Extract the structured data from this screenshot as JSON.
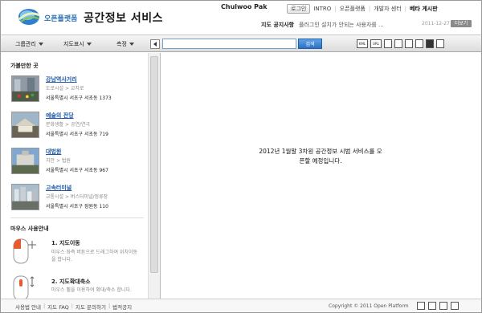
{
  "header": {
    "brand_small": "오픈플랫폼",
    "brand_big": "공간정보 서비스",
    "user_name": "Chulwoo Pak",
    "login_label": "로그인",
    "links": [
      "INTRO",
      "오픈플랫폼",
      "개발자 센터",
      "베타 게시판"
    ],
    "notice_label": "지도 공지사항",
    "notice_text": "플러그인 설치가 안되는 사용자를 ...",
    "notice_date": "2011-12-27",
    "notice_button": "더보기"
  },
  "toolbar": {
    "menus": [
      "그룹관리",
      "지도표시",
      "측정"
    ],
    "search_value": "",
    "search_button": "검색",
    "tools": [
      "KML",
      "URL",
      "save",
      "print",
      "save-image",
      "edit",
      "erase",
      "ruler"
    ]
  },
  "sidebar": {
    "section_title": "가볼만한 곳",
    "places": [
      {
        "name": "강남역사거리",
        "category": "도로시설 > 교차로",
        "address": "서울특별시 서초구 서초동 1373"
      },
      {
        "name": "예술의 전당",
        "category": "문화생활 > 공연/연극",
        "address": "서울특별시 서초구 서초동 719"
      },
      {
        "name": "대법원",
        "category": "치안 > 법원",
        "address": "서울특별시 서초구 서초동 967"
      },
      {
        "name": "고속터미널",
        "category": "교통시설 > 버스터미널/정류장",
        "address": "서울특별시 서초구 잠원동 110"
      }
    ],
    "mouse_title": "마우스 사용안내",
    "mouse_items": [
      {
        "title": "1. 지도이동",
        "desc": "마우스 좌측 버튼으로 드래그하여 위치이동을 합니다."
      },
      {
        "title": "2. 지도확대축소",
        "desc": "마우스 휠을 이용하여 확대/축소 합니다."
      }
    ]
  },
  "map": {
    "message": "2012년 1월말 3차원 공간정보 시범 서비스를 오픈할 예정입니다."
  },
  "footer": {
    "links": [
      "사용법 안내",
      "지도 FAQ",
      "지도 문의하기",
      "법적공지"
    ],
    "copyright": "Copyright © 2011 Open Platform"
  }
}
